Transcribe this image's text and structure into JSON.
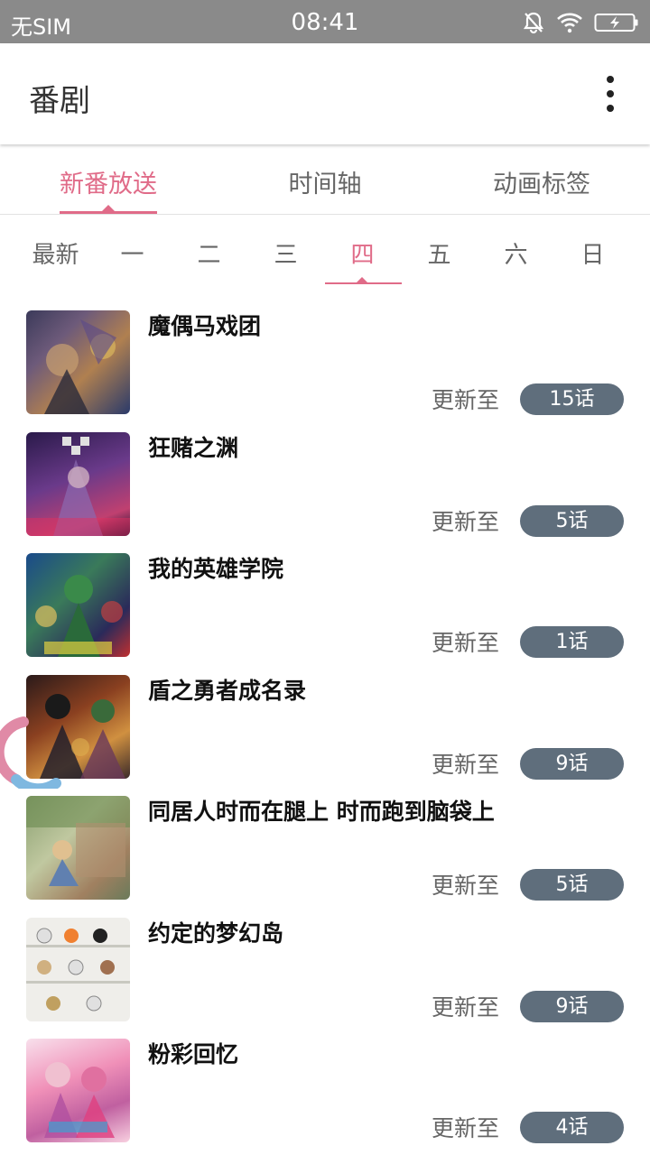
{
  "status_bar": {
    "carrier": "无SIM",
    "time": "08:41",
    "icons": [
      "mute-icon",
      "wifi-icon",
      "battery-charging-icon"
    ]
  },
  "app_bar": {
    "title": "番剧",
    "menu_icon": "more-vert-icon"
  },
  "main_tabs": [
    {
      "label": "新番放送",
      "active": true
    },
    {
      "label": "时间轴",
      "active": false
    },
    {
      "label": "动画标签",
      "active": false
    }
  ],
  "day_tabs": [
    {
      "label": "最新"
    },
    {
      "label": "一"
    },
    {
      "label": "二"
    },
    {
      "label": "三"
    },
    {
      "label": "四",
      "active": true
    },
    {
      "label": "五"
    },
    {
      "label": "六"
    },
    {
      "label": "日"
    }
  ],
  "shows": [
    {
      "title": "魔偶马戏团",
      "update_label": "更新至",
      "episode": "15话"
    },
    {
      "title": "狂赌之渊",
      "update_label": "更新至",
      "episode": "5话"
    },
    {
      "title": "我的英雄学院",
      "update_label": "更新至",
      "episode": "1话"
    },
    {
      "title": "盾之勇者成名录",
      "update_label": "更新至",
      "episode": "9话"
    },
    {
      "title": "同居人时而在腿上 时而跑到脑袋上",
      "update_label": "更新至",
      "episode": "5话"
    },
    {
      "title": "约定的梦幻岛",
      "update_label": "更新至",
      "episode": "9话"
    },
    {
      "title": "粉彩回忆",
      "update_label": "更新至",
      "episode": "4话"
    }
  ],
  "colors": {
    "accent": "#e06b88",
    "badge": "#5f6e7c",
    "status_bar": "#8a8a8a"
  }
}
